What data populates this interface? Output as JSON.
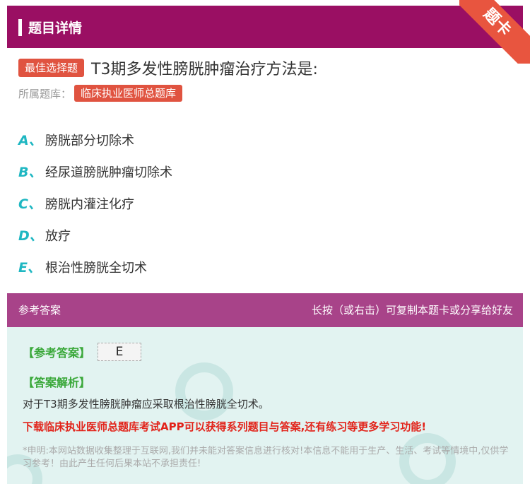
{
  "header": {
    "title": "题目详情",
    "ribbon": "题卡"
  },
  "question": {
    "type_tag": "最佳选择题",
    "text": "T3期多发性膀胱肿瘤治疗方法是:",
    "bank_label": "所属题库：",
    "bank_name": "临床执业医师总题库"
  },
  "options": [
    {
      "letter": "A、",
      "text": "膀胱部分切除术"
    },
    {
      "letter": "B、",
      "text": "经尿道膀胱肿瘤切除术"
    },
    {
      "letter": "C、",
      "text": "膀胱内灌注化疗"
    },
    {
      "letter": "D、",
      "text": "放疗"
    },
    {
      "letter": "E、",
      "text": "根治性膀胱全切术"
    }
  ],
  "answer": {
    "header_left": "参考答案",
    "header_right": "长按（或右击）可复制本题卡或分享给好友",
    "answer_label": "【参考答案】",
    "answer_value": "E",
    "analysis_label": "【答案解析】",
    "analysis_text": "对于T3期多发性膀胱肿瘤应采取根治性膀胱全切术。",
    "promo": "下载临床执业医师总题库考试APP可以获得系列题目与答案,还有练习等更多学习功能!",
    "disclaimer": "*申明:本网站数据收集整理于互联网,我们并未能对答案信息进行核对!本信息不能用于生产、生活、考试等情境中,仅供学习参考！由此产生任何后果本站不承担责任!"
  },
  "colors": {
    "header": "#9a0f63",
    "accent": "#e05340",
    "option_letter": "#1fb7c2",
    "answer_bg": "#e2f3f1"
  }
}
